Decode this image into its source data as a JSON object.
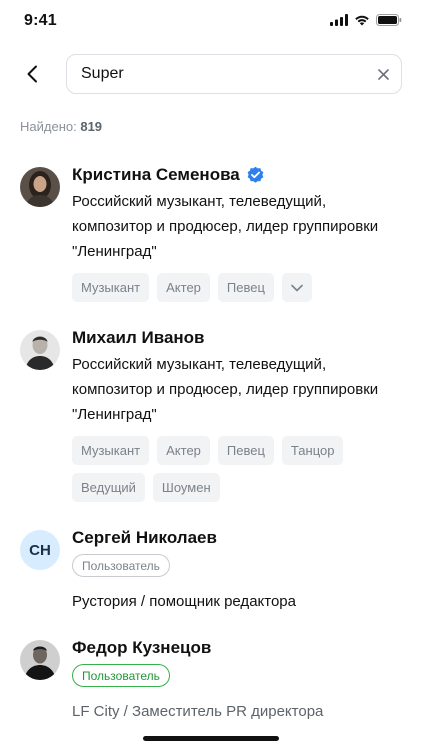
{
  "status_bar": {
    "time": "9:41"
  },
  "search": {
    "value": "Super"
  },
  "results_count": {
    "label": "Найдено:",
    "count": "819"
  },
  "results": [
    {
      "name": "Кристина Семенова",
      "verified": true,
      "description": "Российский музыкант, телеведущий, композитор и продюсер, лидер группировки \"Ленинград\"",
      "tags": [
        "Музыкант",
        "Актер",
        "Певец"
      ]
    },
    {
      "name": "Михаил Иванов",
      "description": "Российский музыкант, телеведущий, композитор и продюсер, лидер группировки \"Ленинград\"",
      "tags": [
        "Музыкант",
        "Актер",
        "Певец",
        "Танцор",
        "Ведущий",
        "Шоумен"
      ]
    },
    {
      "name": "Сергей Николаев",
      "initials": "СН",
      "role": "Пользователь",
      "subtitle": "Рустория / помощник редактора"
    },
    {
      "name": "Федор Кузнецов",
      "role": "Пользователь",
      "subtitle": "LF City / Заместитель PR директора"
    }
  ],
  "colors": {
    "verified": "#2f80ed",
    "role_active": "#36b24a",
    "tag_bg": "#f1f3f5",
    "initials_bg": "#d7ecff"
  },
  "icons": [
    "back-arrow-icon",
    "clear-icon",
    "verified-icon",
    "chevron-down-icon",
    "signal-icon",
    "wifi-icon",
    "battery-icon"
  ]
}
